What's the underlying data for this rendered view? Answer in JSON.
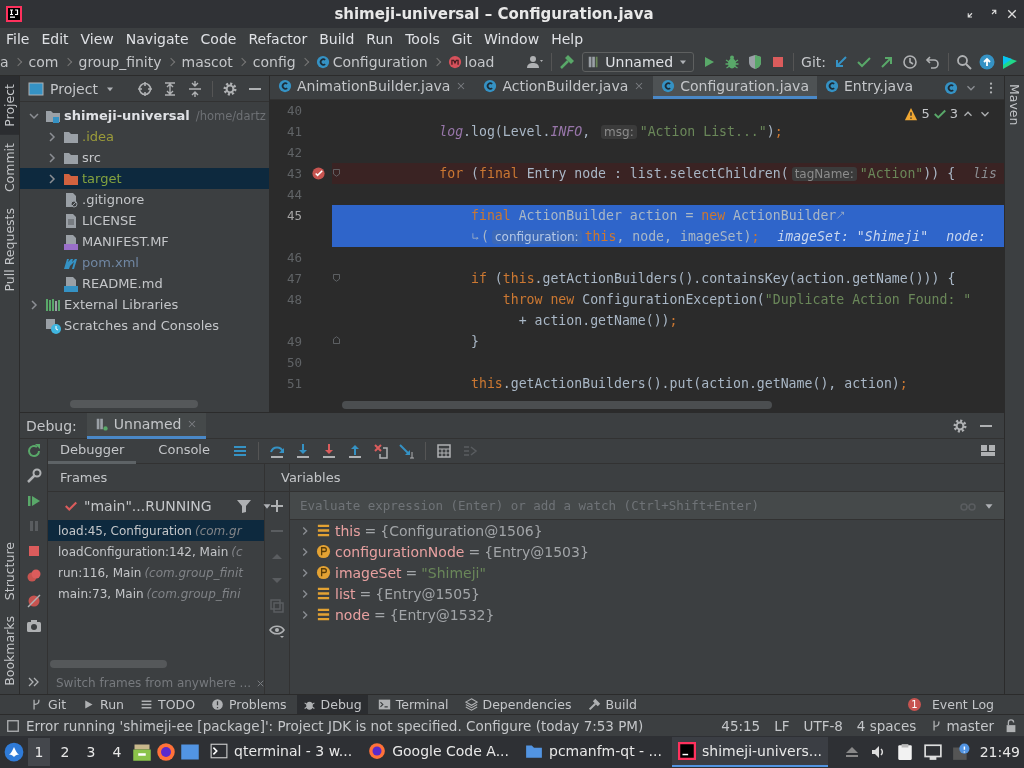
{
  "window": {
    "title": "shimeji-universal – Configuration.java"
  },
  "menu": [
    "File",
    "Edit",
    "View",
    "Navigate",
    "Code",
    "Refactor",
    "Build",
    "Run",
    "Tools",
    "Git",
    "Window",
    "Help"
  ],
  "breadcrumbs": [
    {
      "label": "a",
      "kind": "package"
    },
    {
      "label": "com",
      "kind": "package"
    },
    {
      "label": "group_finity",
      "kind": "package"
    },
    {
      "label": "mascot",
      "kind": "package"
    },
    {
      "label": "config",
      "kind": "package"
    },
    {
      "label": "Configuration",
      "kind": "class"
    },
    {
      "label": "load",
      "kind": "method"
    }
  ],
  "toolbar": {
    "run_config": "Unnamed",
    "git_label": "Git:"
  },
  "left_stripe_top": [
    {
      "label": "Project",
      "selected": true
    },
    {
      "label": "Commit",
      "selected": false
    },
    {
      "label": "Pull Requests",
      "selected": false
    }
  ],
  "left_stripe_bottom": [
    {
      "label": "Structure",
      "selected": false
    },
    {
      "label": "Bookmarks",
      "selected": false
    }
  ],
  "right_stripe": [
    {
      "label": "Maven",
      "selected": false
    }
  ],
  "project": {
    "title": "Project",
    "tree": [
      {
        "label": "shimeji-universal",
        "path": "/home/dartz",
        "kind": "module",
        "expanded": true,
        "selected": false,
        "color": "#dfe1e5",
        "children": [
          {
            "label": ".idea",
            "kind": "folder",
            "expanded": false,
            "selected": false,
            "color": "#9c9c3a"
          },
          {
            "label": "src",
            "kind": "folder",
            "expanded": false,
            "selected": false,
            "color": "#c4c6c9"
          },
          {
            "label": "target",
            "kind": "excluded-folder",
            "expanded": false,
            "selected": true,
            "color": "#84a23f"
          },
          {
            "label": ".gitignore",
            "kind": "ignore-file",
            "selected": false,
            "color": "#c4c6c9"
          },
          {
            "label": "LICENSE",
            "kind": "text-file",
            "selected": false,
            "color": "#c4c6c9"
          },
          {
            "label": "MANIFEST.MF",
            "kind": "manifest-file",
            "selected": false,
            "color": "#c4c6c9"
          },
          {
            "label": "pom.xml",
            "kind": "maven-file",
            "selected": false,
            "color": "#7087a3"
          },
          {
            "label": "README.md",
            "kind": "markdown-file",
            "selected": false,
            "color": "#c4c6c9"
          }
        ]
      },
      {
        "label": "External Libraries",
        "kind": "libraries",
        "expanded": false,
        "selected": false,
        "color": "#c4c6c9"
      },
      {
        "label": "Scratches and Consoles",
        "kind": "scratches",
        "selected": false,
        "color": "#c4c6c9"
      }
    ]
  },
  "editor": {
    "tabs": [
      {
        "label": "AnimationBuilder.java",
        "selected": false,
        "closable": true
      },
      {
        "label": "ActionBuilder.java",
        "selected": false,
        "closable": true
      },
      {
        "label": "Configuration.java",
        "selected": true,
        "closable": false
      },
      {
        "label": "Entry.java",
        "selected": false,
        "closable": false
      }
    ],
    "warnings": "5",
    "passed": "3",
    "lines": [
      {
        "number": "40",
        "selected": false,
        "breakpoint": false
      },
      {
        "number": "41",
        "selected": false,
        "breakpoint": false,
        "segments": [
          {
            "kind": "field",
            "text": "            log"
          },
          {
            "kind": "plain",
            "text": ".log(Level."
          },
          {
            "kind": "constant",
            "text": "INFO"
          },
          {
            "kind": "plain",
            "text": ", "
          },
          {
            "kind": "hint",
            "text": "msg:"
          },
          {
            "kind": "string",
            "text": "\"Action List...\""
          },
          {
            "kind": "plain",
            "text": ")"
          },
          {
            "kind": "keyword",
            "text": ";"
          }
        ]
      },
      {
        "number": "42",
        "selected": false,
        "breakpoint": false
      },
      {
        "number": "43",
        "selected": false,
        "breakpoint": true,
        "fold_start": true,
        "segments": [
          {
            "kind": "keyword",
            "text": "            for "
          },
          {
            "kind": "plain",
            "text": "("
          },
          {
            "kind": "keyword",
            "text": "final "
          },
          {
            "kind": "plain",
            "text": "Entry node : list.selectChildren("
          },
          {
            "kind": "hint",
            "text": "tagName:"
          },
          {
            "kind": "string",
            "text": "\"Action\""
          },
          {
            "kind": "plain",
            "text": ")) {"
          },
          {
            "kind": "value",
            "text": "lis"
          }
        ]
      },
      {
        "number": "44",
        "selected": false,
        "breakpoint": false
      },
      {
        "number": "45",
        "selected": true,
        "breakpoint": false,
        "segments": [
          {
            "kind": "keyword",
            "text": "                final "
          },
          {
            "kind": "plain",
            "text": "ActionBuilder action = "
          },
          {
            "kind": "keyword",
            "text": "new "
          },
          {
            "kind": "plain",
            "text": "ActionBuilder"
          }
        ],
        "wrap": [
          {
            "kind": "plain",
            "text": "("
          },
          {
            "kind": "hint",
            "text": "configuration:"
          },
          {
            "kind": "keyword",
            "text": "this"
          },
          {
            "kind": "plain",
            "text": ", node, imageSet)"
          },
          {
            "kind": "keyword",
            "text": ";"
          },
          {
            "kind": "value",
            "text": "imageSet: \"Shimeji\""
          },
          {
            "kind": "value",
            "text": "node:"
          }
        ]
      },
      {
        "number": "46",
        "selected": false,
        "breakpoint": false
      },
      {
        "number": "47",
        "selected": false,
        "breakpoint": false,
        "fold_start": true,
        "segments": [
          {
            "kind": "keyword",
            "text": "                if "
          },
          {
            "kind": "plain",
            "text": "("
          },
          {
            "kind": "keyword",
            "text": "this"
          },
          {
            "kind": "plain",
            "text": ".getActionBuilders().containsKey(action.getName())) {"
          }
        ]
      },
      {
        "number": "48",
        "selected": false,
        "breakpoint": false,
        "segments": [
          {
            "kind": "keyword",
            "text": "                    throw new "
          },
          {
            "kind": "plain",
            "text": "ConfigurationException("
          },
          {
            "kind": "string",
            "text": "\"Duplicate Action Found: \""
          }
        ],
        "wrap": [
          {
            "kind": "plain",
            "text": "+ action.getName())"
          },
          {
            "kind": "keyword",
            "text": ";"
          }
        ]
      },
      {
        "number": "49",
        "selected": false,
        "breakpoint": false,
        "fold_end": true,
        "segments": [
          {
            "kind": "plain",
            "text": "                }"
          }
        ]
      },
      {
        "number": "50",
        "selected": false,
        "breakpoint": false
      },
      {
        "number": "51",
        "selected": false,
        "breakpoint": false,
        "segments": [
          {
            "kind": "keyword",
            "text": "                this"
          },
          {
            "kind": "plain",
            "text": ".getActionBuilders().put(action.getName(), action)"
          },
          {
            "kind": "keyword",
            "text": ";"
          }
        ]
      }
    ]
  },
  "debug": {
    "title": "Debug:",
    "session": "Unnamed",
    "tabs": [
      {
        "label": "Debugger",
        "selected": true
      },
      {
        "label": "Console",
        "selected": false
      }
    ],
    "frames_title": "Frames",
    "variables_title": "Variables",
    "thread": "\"main\"...RUNNING",
    "frames": [
      {
        "method": "load:45, Configuration",
        "package": "(com.gr",
        "selected": true
      },
      {
        "method": "loadConfiguration:142, Main",
        "package": "(c",
        "selected": false
      },
      {
        "method": "run:116, Main",
        "package": "(com.group_finit",
        "selected": false
      },
      {
        "method": "main:73, Main",
        "package": "(com.group_fini",
        "selected": false
      }
    ],
    "hint": "Switch frames from anywhere ...",
    "evaluate_placeholder": "Evaluate expression (Enter) or add a watch (Ctrl+Shift+Enter)",
    "variables": [
      {
        "kind": "field",
        "name": "this",
        "operator": "=",
        "value": "{Configuration@1506}",
        "color": "#a2a5a8"
      },
      {
        "kind": "parameter",
        "name": "configurationNode",
        "operator": "=",
        "value": "{Entry@1503}",
        "color": "#a2a5a8"
      },
      {
        "kind": "parameter",
        "name": "imageSet",
        "operator": "=",
        "value": "\"Shimeji\"",
        "color": "#6a8759"
      },
      {
        "kind": "field",
        "name": "list",
        "operator": "=",
        "value": "{Entry@1505}",
        "color": "#a2a5a8"
      },
      {
        "kind": "field",
        "name": "node",
        "operator": "=",
        "value": "{Entry@1532}",
        "color": "#a2a5a8"
      }
    ]
  },
  "tool_windows": [
    {
      "label": "Git",
      "kind": "git",
      "selected": false
    },
    {
      "label": "Run",
      "kind": "run",
      "selected": false
    },
    {
      "label": "TODO",
      "kind": "todo",
      "selected": false
    },
    {
      "label": "Problems",
      "kind": "problems",
      "selected": false
    },
    {
      "label": "Debug",
      "kind": "debug",
      "selected": true
    },
    {
      "label": "Terminal",
      "kind": "terminal",
      "selected": false
    },
    {
      "label": "Dependencies",
      "kind": "dependencies",
      "selected": false
    },
    {
      "label": "Build",
      "kind": "build",
      "selected": false
    }
  ],
  "event_log": {
    "label": "Event Log",
    "count": "1"
  },
  "status_bar": {
    "message": "Error running 'shimeji-ee [package]': Project JDK is not specified. Configure (today 7:53 PM)",
    "position": "45:15",
    "line_ending": "LF",
    "encoding": "UTF-8",
    "indent": "4 spaces",
    "branch": "master"
  },
  "taskbar": {
    "workspaces": [
      {
        "label": "1",
        "selected": true
      },
      {
        "label": "2",
        "selected": false
      },
      {
        "label": "3",
        "selected": false
      },
      {
        "label": "4",
        "selected": false
      }
    ],
    "tasks": [
      {
        "label": "qterminal - 3 w...",
        "kind": "terminal",
        "selected": false
      },
      {
        "label": "Google Code A...",
        "kind": "browser",
        "selected": false
      },
      {
        "label": "pcmanfm-qt - ...",
        "kind": "files",
        "selected": false
      },
      {
        "label": "shimeji-univers...",
        "kind": "ide",
        "selected": true
      }
    ],
    "clock": "21:49"
  }
}
